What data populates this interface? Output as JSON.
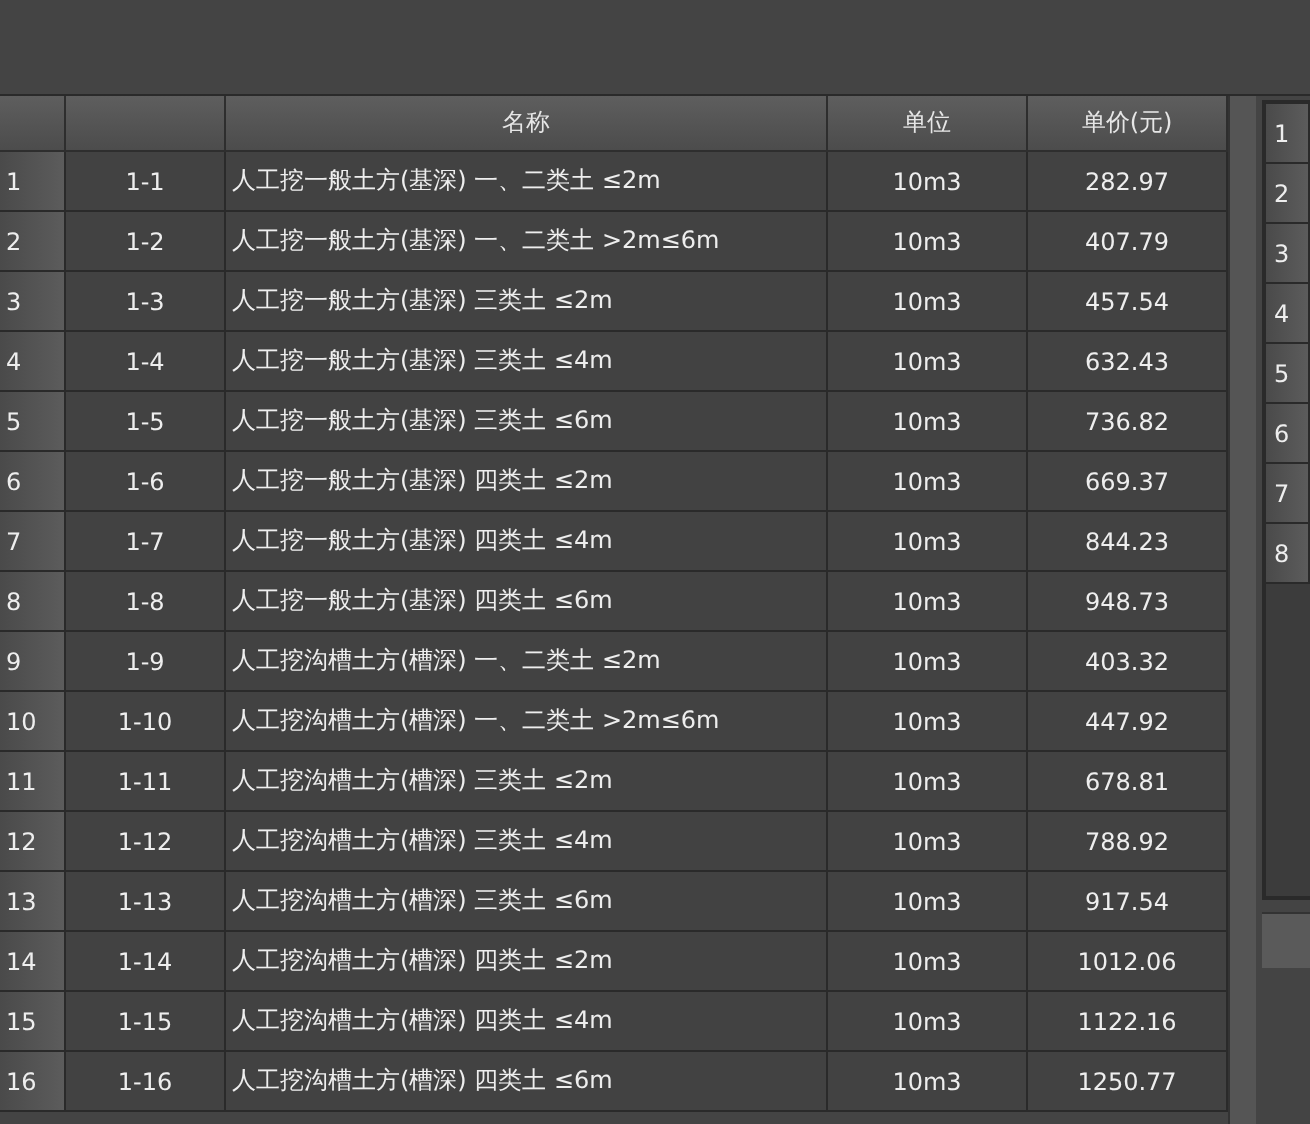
{
  "table": {
    "columns": [
      {},
      {},
      {
        "label": "名称"
      },
      {
        "label": "单位"
      },
      {
        "label": "单价(元)"
      }
    ],
    "rows": [
      {
        "index": "1",
        "code": "1-1",
        "name": "人工挖一般土方(基深) 一、二类土 ≤2m",
        "unit": "10m3",
        "price": "282.97"
      },
      {
        "index": "2",
        "code": "1-2",
        "name": "人工挖一般土方(基深) 一、二类土 >2m≤6m",
        "unit": "10m3",
        "price": "407.79"
      },
      {
        "index": "3",
        "code": "1-3",
        "name": "人工挖一般土方(基深) 三类土 ≤2m",
        "unit": "10m3",
        "price": "457.54"
      },
      {
        "index": "4",
        "code": "1-4",
        "name": "人工挖一般土方(基深) 三类土 ≤4m",
        "unit": "10m3",
        "price": "632.43"
      },
      {
        "index": "5",
        "code": "1-5",
        "name": "人工挖一般土方(基深) 三类土 ≤6m",
        "unit": "10m3",
        "price": "736.82"
      },
      {
        "index": "6",
        "code": "1-6",
        "name": "人工挖一般土方(基深) 四类土 ≤2m",
        "unit": "10m3",
        "price": "669.37"
      },
      {
        "index": "7",
        "code": "1-7",
        "name": "人工挖一般土方(基深) 四类土 ≤4m",
        "unit": "10m3",
        "price": "844.23"
      },
      {
        "index": "8",
        "code": "1-8",
        "name": "人工挖一般土方(基深) 四类土 ≤6m",
        "unit": "10m3",
        "price": "948.73"
      },
      {
        "index": "9",
        "code": "1-9",
        "name": "人工挖沟槽土方(槽深) 一、二类土 ≤2m",
        "unit": "10m3",
        "price": "403.32"
      },
      {
        "index": "10",
        "code": "1-10",
        "name": "人工挖沟槽土方(槽深) 一、二类土 >2m≤6m",
        "unit": "10m3",
        "price": "447.92"
      },
      {
        "index": "11",
        "code": "1-11",
        "name": "人工挖沟槽土方(槽深) 三类土 ≤2m",
        "unit": "10m3",
        "price": "678.81"
      },
      {
        "index": "12",
        "code": "1-12",
        "name": "人工挖沟槽土方(槽深) 三类土 ≤4m",
        "unit": "10m3",
        "price": "788.92"
      },
      {
        "index": "13",
        "code": "1-13",
        "name": "人工挖沟槽土方(槽深) 三类土 ≤6m",
        "unit": "10m3",
        "price": "917.54"
      },
      {
        "index": "14",
        "code": "1-14",
        "name": "人工挖沟槽土方(槽深) 四类土 ≤2m",
        "unit": "10m3",
        "price": "1012.06"
      },
      {
        "index": "15",
        "code": "1-15",
        "name": "人工挖沟槽土方(槽深) 四类土 ≤4m",
        "unit": "10m3",
        "price": "1122.16"
      },
      {
        "index": "16",
        "code": "1-16",
        "name": "人工挖沟槽土方(槽深) 四类土 ≤6m",
        "unit": "10m3",
        "price": "1250.77"
      }
    ]
  },
  "side_table": {
    "rows": [
      "1",
      "2",
      "3",
      "4",
      "5",
      "6",
      "7",
      "8"
    ]
  }
}
